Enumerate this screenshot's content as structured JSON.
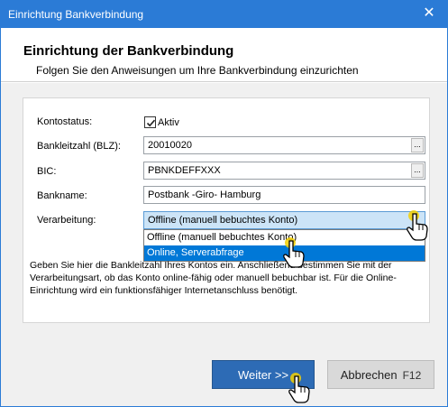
{
  "window": {
    "title": "Einrichtung Bankverbindung",
    "close_glyph": "✕"
  },
  "header": {
    "title": "Einrichtung der Bankverbindung",
    "subtitle": "Folgen Sie den Anweisungen um Ihre Bankverbindung einzurichten"
  },
  "form": {
    "status": {
      "label": "Kontostatus:",
      "checkbox_label": "Aktiv",
      "checked": true
    },
    "blz": {
      "label": "Bankleitzahl (BLZ):",
      "value": "20010020",
      "button": "..."
    },
    "bic": {
      "label": "BIC:",
      "value": "PBNKDEFFXXX",
      "button": "..."
    },
    "bankname": {
      "label": "Bankname:",
      "value": "Postbank -Giro- Hamburg"
    },
    "verarbeitung": {
      "label": "Verarbeitung:",
      "selected": "Offline (manuell bebuchtes Konto)",
      "options": [
        "Offline (manuell bebuchtes Konto)",
        "Online, Serverabfrage"
      ],
      "highlighted_option": "Online, Serverabfrage"
    }
  },
  "help_text": "Geben Sie hier die Bankleitzahl Ihres Kontos ein. Anschließend bestimmen Sie mit der Verarbeitungsart, ob das Konto online-fähig oder manuell bebuchbar ist. Für die Online-Einrichtung wird ein funktionsfähiger Internetanschluss benötigt.",
  "buttons": {
    "next": "Weiter >>",
    "cancel": "Abbrechen",
    "cancel_hint": "F12"
  },
  "colors": {
    "accent": "#2b7bd6",
    "primary_button": "#2d6bb5",
    "selection": "#0078d7"
  },
  "icons": {
    "checkbox": "checkmark-icon",
    "cursor": "hand-pointer-icon"
  }
}
